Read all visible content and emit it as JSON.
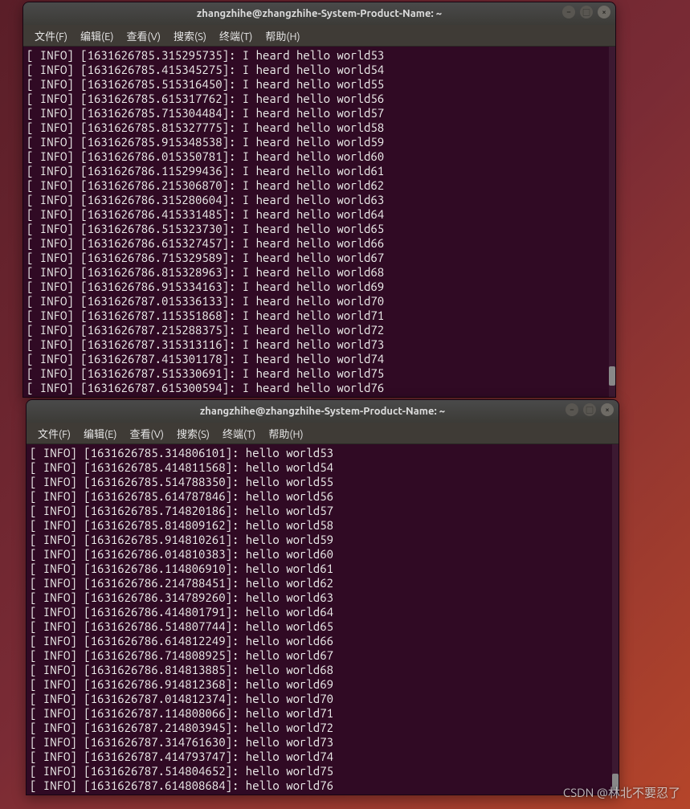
{
  "menus": {
    "file": "文件(F)",
    "edit": "编辑(E)",
    "view": "查看(V)",
    "search": "搜索(S)",
    "terminal": "终端(T)",
    "help": "帮助(H)"
  },
  "windows": [
    {
      "title": "zhangzhihe@zhangzhihe-System-Product-Name: ~",
      "prefix": "I heard hello world",
      "lines": [
        {
          "ts": "1631626785.315295735",
          "n": 53
        },
        {
          "ts": "1631626785.415345275",
          "n": 54
        },
        {
          "ts": "1631626785.515316450",
          "n": 55
        },
        {
          "ts": "1631626785.615317762",
          "n": 56
        },
        {
          "ts": "1631626785.715304484",
          "n": 57
        },
        {
          "ts": "1631626785.815327775",
          "n": 58
        },
        {
          "ts": "1631626785.915348538",
          "n": 59
        },
        {
          "ts": "1631626786.015350781",
          "n": 60
        },
        {
          "ts": "1631626786.115299436",
          "n": 61
        },
        {
          "ts": "1631626786.215306870",
          "n": 62
        },
        {
          "ts": "1631626786.315280604",
          "n": 63
        },
        {
          "ts": "1631626786.415331485",
          "n": 64
        },
        {
          "ts": "1631626786.515323730",
          "n": 65
        },
        {
          "ts": "1631626786.615327457",
          "n": 66
        },
        {
          "ts": "1631626786.715329589",
          "n": 67
        },
        {
          "ts": "1631626786.815328963",
          "n": 68
        },
        {
          "ts": "1631626786.915334163",
          "n": 69
        },
        {
          "ts": "1631626787.015336133",
          "n": 70
        },
        {
          "ts": "1631626787.115351868",
          "n": 71
        },
        {
          "ts": "1631626787.215288375",
          "n": 72
        },
        {
          "ts": "1631626787.315313116",
          "n": 73
        },
        {
          "ts": "1631626787.415301178",
          "n": 74
        },
        {
          "ts": "1631626787.515330691",
          "n": 75
        },
        {
          "ts": "1631626787.615300594",
          "n": 76
        }
      ]
    },
    {
      "title": "zhangzhihe@zhangzhihe-System-Product-Name: ~",
      "prefix": "hello world",
      "lines": [
        {
          "ts": "1631626785.314806101",
          "n": 53
        },
        {
          "ts": "1631626785.414811568",
          "n": 54
        },
        {
          "ts": "1631626785.514788350",
          "n": 55
        },
        {
          "ts": "1631626785.614787846",
          "n": 56
        },
        {
          "ts": "1631626785.714820186",
          "n": 57
        },
        {
          "ts": "1631626785.814809162",
          "n": 58
        },
        {
          "ts": "1631626785.914810261",
          "n": 59
        },
        {
          "ts": "1631626786.014810383",
          "n": 60
        },
        {
          "ts": "1631626786.114806910",
          "n": 61
        },
        {
          "ts": "1631626786.214788451",
          "n": 62
        },
        {
          "ts": "1631626786.314789260",
          "n": 63
        },
        {
          "ts": "1631626786.414801791",
          "n": 64
        },
        {
          "ts": "1631626786.514807744",
          "n": 65
        },
        {
          "ts": "1631626786.614812249",
          "n": 66
        },
        {
          "ts": "1631626786.714808925",
          "n": 67
        },
        {
          "ts": "1631626786.814813885",
          "n": 68
        },
        {
          "ts": "1631626786.914812368",
          "n": 69
        },
        {
          "ts": "1631626787.014812374",
          "n": 70
        },
        {
          "ts": "1631626787.114808066",
          "n": 71
        },
        {
          "ts": "1631626787.214803945",
          "n": 72
        },
        {
          "ts": "1631626787.314761630",
          "n": 73
        },
        {
          "ts": "1631626787.414793747",
          "n": 74
        },
        {
          "ts": "1631626787.514804652",
          "n": 75
        },
        {
          "ts": "1631626787.614808684",
          "n": 76
        }
      ]
    }
  ],
  "watermark": "CSDN @林北不要忍了"
}
